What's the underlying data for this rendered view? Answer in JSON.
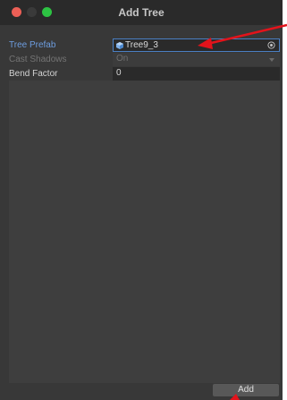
{
  "window": {
    "title": "Add Tree"
  },
  "fields": {
    "tree_prefab": {
      "label": "Tree Prefab",
      "value": "Tree9_3",
      "icon": "prefab-cube-icon",
      "picker_icon": "object-picker-icon"
    },
    "cast_shadows": {
      "label": "Cast Shadows",
      "value": "On"
    },
    "bend_factor": {
      "label": "Bend Factor",
      "value": "0"
    }
  },
  "footer": {
    "add_label": "Add"
  },
  "colors": {
    "active_label": "#6d9ddf",
    "field_border_focus": "#4a7fc2",
    "annotation_arrow": "#e3131b"
  }
}
